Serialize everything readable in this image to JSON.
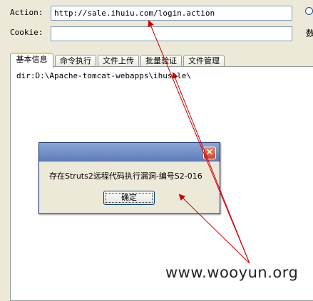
{
  "form": {
    "action_label": "Action:",
    "action_value": "http://sale.ihuiu.com/login.action",
    "cookie_label": "Cookie:",
    "cookie_value": "",
    "side_text": "数"
  },
  "tabs": [
    {
      "label": "基本信息",
      "active": true
    },
    {
      "label": "命令执行",
      "active": false
    },
    {
      "label": "文件上传",
      "active": false
    },
    {
      "label": "批量验证",
      "active": false
    },
    {
      "label": "文件管理",
      "active": false
    }
  ],
  "panel": {
    "text": "dir:D:\\Apache-tomcat-webapps\\ihusale\\"
  },
  "dialog": {
    "title": "",
    "close_glyph": "✕",
    "message": "存在Struts2远程代码执行漏洞-编号S2-016",
    "ok_label": "确定"
  },
  "annotation": {
    "arrow_color": "#cc0000"
  },
  "watermark": "www.wooyun.org"
}
